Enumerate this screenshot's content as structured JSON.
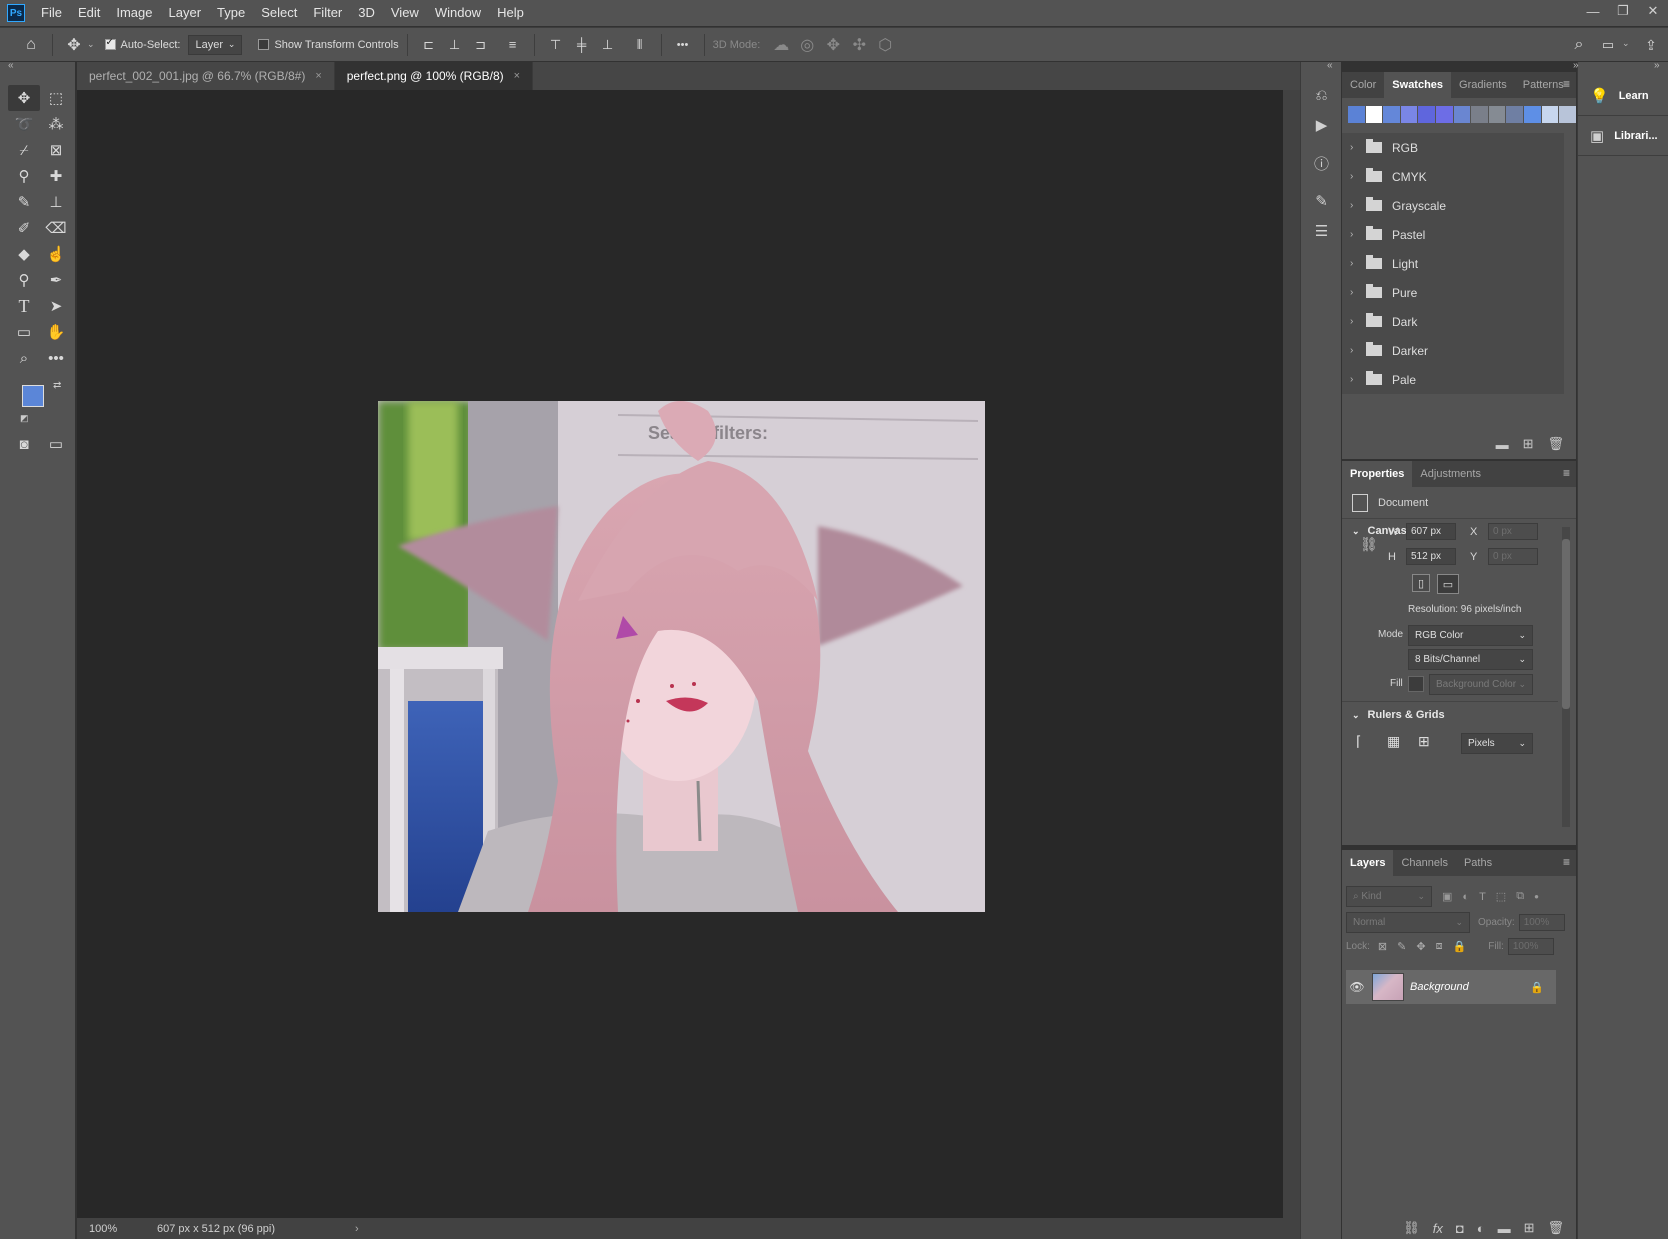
{
  "app": {
    "logo": "Ps"
  },
  "menu": [
    "File",
    "Edit",
    "Image",
    "Layer",
    "Type",
    "Select",
    "Filter",
    "3D",
    "View",
    "Window",
    "Help"
  ],
  "window_controls": [
    "—",
    "❐",
    "✕"
  ],
  "options": {
    "auto_select_label": "Auto-Select:",
    "auto_select_value": "Layer",
    "show_transform_label": "Show Transform Controls",
    "mode_3d_label": "3D Mode:",
    "more": "•••"
  },
  "tabs": [
    {
      "title": "perfect_002_001.jpg @ 66.7% (RGB/8#)",
      "close": "×"
    },
    {
      "title": "perfect.png @ 100% (RGB/8)",
      "close": "×"
    }
  ],
  "image_text": "Search filters:",
  "status": {
    "zoom": "100%",
    "doc_info": "607 px x 512 px (96 ppi)",
    "arrow": "›"
  },
  "right_strip": [
    {
      "label": "Learn",
      "icon": "lightbulb-icon"
    },
    {
      "label": "Librari...",
      "icon": "libraries-icon"
    }
  ],
  "swatches_panel": {
    "tabs": [
      "Color",
      "Swatches",
      "Gradients",
      "Patterns"
    ],
    "active_tab": "Swatches",
    "colors": [
      "#5b82d6",
      "#ffffff",
      "#6487d9",
      "#7a86e6",
      "#5f66dd",
      "#6d6de6",
      "#6a86d1",
      "#7a7f8a",
      "#858b93",
      "#6f7fa3",
      "#5e8fe6",
      "#c7d6ee",
      "#b8c4d9"
    ],
    "folders": [
      "RGB",
      "CMYK",
      "Grayscale",
      "Pastel",
      "Light",
      "Pure",
      "Dark",
      "Darker",
      "Pale"
    ]
  },
  "properties_panel": {
    "tabs": [
      "Properties",
      "Adjustments"
    ],
    "active_tab": "Properties",
    "document_label": "Document",
    "canvas_title": "Canvas",
    "w_label": "W",
    "w_value": "607 px",
    "h_label": "H",
    "h_value": "512 px",
    "x_label": "X",
    "x_value": "0 px",
    "y_label": "Y",
    "y_value": "0 px",
    "resolution": "Resolution: 96 pixels/inch",
    "mode_label": "Mode",
    "mode_value": "RGB Color",
    "bits_value": "8 Bits/Channel",
    "fill_label": "Fill",
    "fill_value": "Background Color",
    "rulers_title": "Rulers & Grids",
    "units_value": "Pixels"
  },
  "layers_panel": {
    "tabs": [
      "Layers",
      "Channels",
      "Paths"
    ],
    "active_tab": "Layers",
    "kind_placeholder": "Kind",
    "blend_mode": "Normal",
    "opacity_label": "Opacity:",
    "opacity_value": "100%",
    "lock_label": "Lock:",
    "fill_label": "Fill:",
    "fill_value": "100%",
    "layers": [
      {
        "name": "Background",
        "visible": true,
        "locked": true
      }
    ]
  },
  "colors": {
    "foreground": "#5b86d8",
    "background": "#9fbcf0",
    "accent": "#31a8ff"
  }
}
